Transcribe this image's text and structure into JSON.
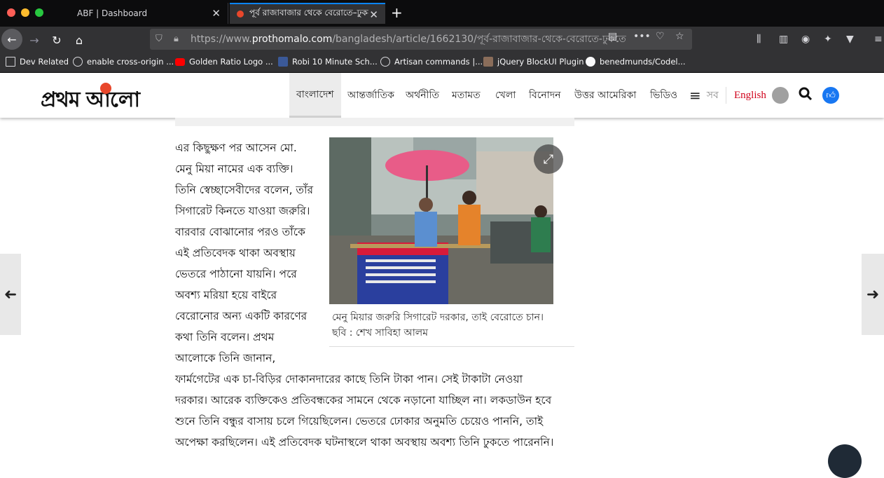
{
  "browser": {
    "tabs": [
      {
        "title": "ABF | Dashboard",
        "active": false
      },
      {
        "title": "পূর্ব রাজাবাজার থেকে বেরোতে–ঢুকতে",
        "active": true
      }
    ],
    "url_prefix": "https://www.",
    "url_host": "prothomalo.com",
    "url_path": "/bangladesh/article/1662130/পূর্ব-রাজাবাজার-থেকে-বেরোতে-ঢুকতে",
    "bookmarks": [
      {
        "label": "Dev Related",
        "icon": "folder-icon"
      },
      {
        "label": "enable cross-origin ...",
        "icon": "globe-icon"
      },
      {
        "label": "Golden Ratio Logo ...",
        "icon": "youtube-icon"
      },
      {
        "label": "Robi 10 Minute Sch...",
        "icon": "facebook-icon"
      },
      {
        "label": "Artisan commands |...",
        "icon": "globe-icon"
      },
      {
        "label": "jQuery BlockUI Plugin",
        "icon": "page-icon"
      },
      {
        "label": "benedmunds/Codel...",
        "icon": "github-icon"
      }
    ],
    "colors": {
      "tab_accent": "#0a84ff",
      "chrome_dark": "#0c0c0d",
      "toolbar": "#323234"
    }
  },
  "site": {
    "logo_text": "প্রথম আলো",
    "menu": [
      "বাংলাদেশ",
      "আন্তর্জাতিক",
      "অর্থনীতি",
      "মতামত",
      "খেলা",
      "বিনোদন",
      "উত্তর আমেরিকা",
      "ভিডিও"
    ],
    "all_label": "সব",
    "english_label": "English",
    "colors": {
      "brand_red": "#d0021b",
      "like_blue": "#1877f2"
    }
  },
  "article": {
    "narrow_lines": [
      "এর কিছুক্ষণ পর আসেন মো.",
      "মেনু মিয়া নামের এক ব্যক্তি।",
      "তিনি স্বেচ্ছাসেবীদের বলেন, তাঁর",
      "সিগারেট কিনতে যাওয়া জরুরি।",
      "বারবার বোঝানোর পরও তাঁকে",
      "এই প্রতিবেদক থাকা অবস্থায়",
      "ভেতরে পাঠানো যায়নি। পরে",
      "অবশ্য মরিয়া হয়ে বাইরে",
      "বেরোনোর অন্য একটি কারণের",
      "কথা তিনি বলেন। প্রথম",
      "আলোকে তিনি জানান,"
    ],
    "wide_lines": [
      "ফার্মগেটের এক চা-বিড়ির দোকানদারের কাছে তিনি টাকা পান। সেই টাকাটা নেওয়া",
      "দরকার। আরেক ব্যক্তিকেও প্রতিবন্ধকের সামনে থেকে নড়ানো যাচ্ছিল না। লকডাউন হবে",
      "শুনে তিনি বন্ধুর বাসায় চলে গিয়েছিলেন। ভেতরে ঢোকার অনুমতি চেয়েও পাননি, তাই",
      "অপেক্ষা করছিলেন। এই প্রতিবেদক ঘটনাস্থলে থাকা অবস্থায় অবশ্য তিনি ঢুকতে পারেননি।"
    ],
    "caption_line1": "মেনু মিয়ার জরুরি সিগারেট দরকার, তাই বেরোতে চান।",
    "caption_line2": "ছবি : শেখ সাবিহা আলম"
  }
}
